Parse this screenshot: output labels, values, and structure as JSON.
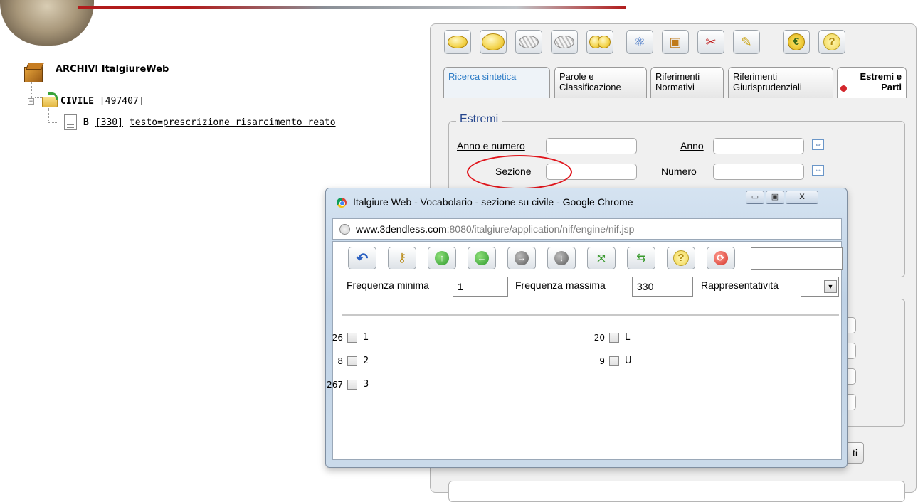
{
  "tree": {
    "root_label": "ARCHIVI ItalgiureWeb",
    "civile_label": "CIVILE",
    "civile_count": "[497407]",
    "doc_letter": "B",
    "doc_count": "[330]",
    "doc_query": "testo=prescrizione risarcimento reato"
  },
  "toolbar": {
    "icons": [
      "yellow-oval-icon",
      "yellow-oval-icon",
      "hatched-oval-icon",
      "hatched-oval-icon",
      "double-oval-icon",
      "atom-icon",
      "box-icon",
      "scissors-icon",
      "eraser-icon",
      "euro-icon",
      "help-icon"
    ],
    "euro_glyph": "€",
    "help_glyph": "?"
  },
  "tabs": [
    {
      "label": "Ricerca sintetica"
    },
    {
      "label": "Parole e Classificazione"
    },
    {
      "label": "Riferimenti Normativi"
    },
    {
      "label": "Riferimenti Giurisprudenziali"
    },
    {
      "label": "Estremi e Parti"
    }
  ],
  "estremi": {
    "legend": "Estremi",
    "anno_numero_label": "Anno e numero",
    "anno_label": "Anno",
    "sezione_label": "Sezione",
    "numero_label": "Numero",
    "anno_numero_value": "",
    "anno_value": "",
    "sezione_value": "",
    "numero_value": ""
  },
  "partial_button_label": "ti",
  "popup": {
    "title": "Italgiure Web - Vocabolario - sezione su civile - Google Chrome",
    "url_host": "www.3dendless.com",
    "url_path": ":8080/italgiure/application/nif/engine/nif.jsp",
    "min_btn": "▭",
    "max_btn": "▣",
    "close_btn": "X",
    "freq_min_label": "Frequenza minima",
    "freq_min_value": "1",
    "freq_max_label": "Frequenza massima",
    "freq_max_value": "330",
    "rappr_label": "Rappresentatività",
    "rappr_value": "",
    "help_glyph": "?",
    "items_left": [
      {
        "count": "26",
        "label": "1"
      },
      {
        "count": "8",
        "label": "2"
      },
      {
        "count": "267",
        "label": "3"
      }
    ],
    "items_right": [
      {
        "count": "20",
        "label": "L"
      },
      {
        "count": "9",
        "label": "U"
      }
    ]
  },
  "colors": {
    "accent_blue": "#2c7bc6",
    "legend_blue": "#24458d",
    "highlight_red": "#e0141b"
  }
}
